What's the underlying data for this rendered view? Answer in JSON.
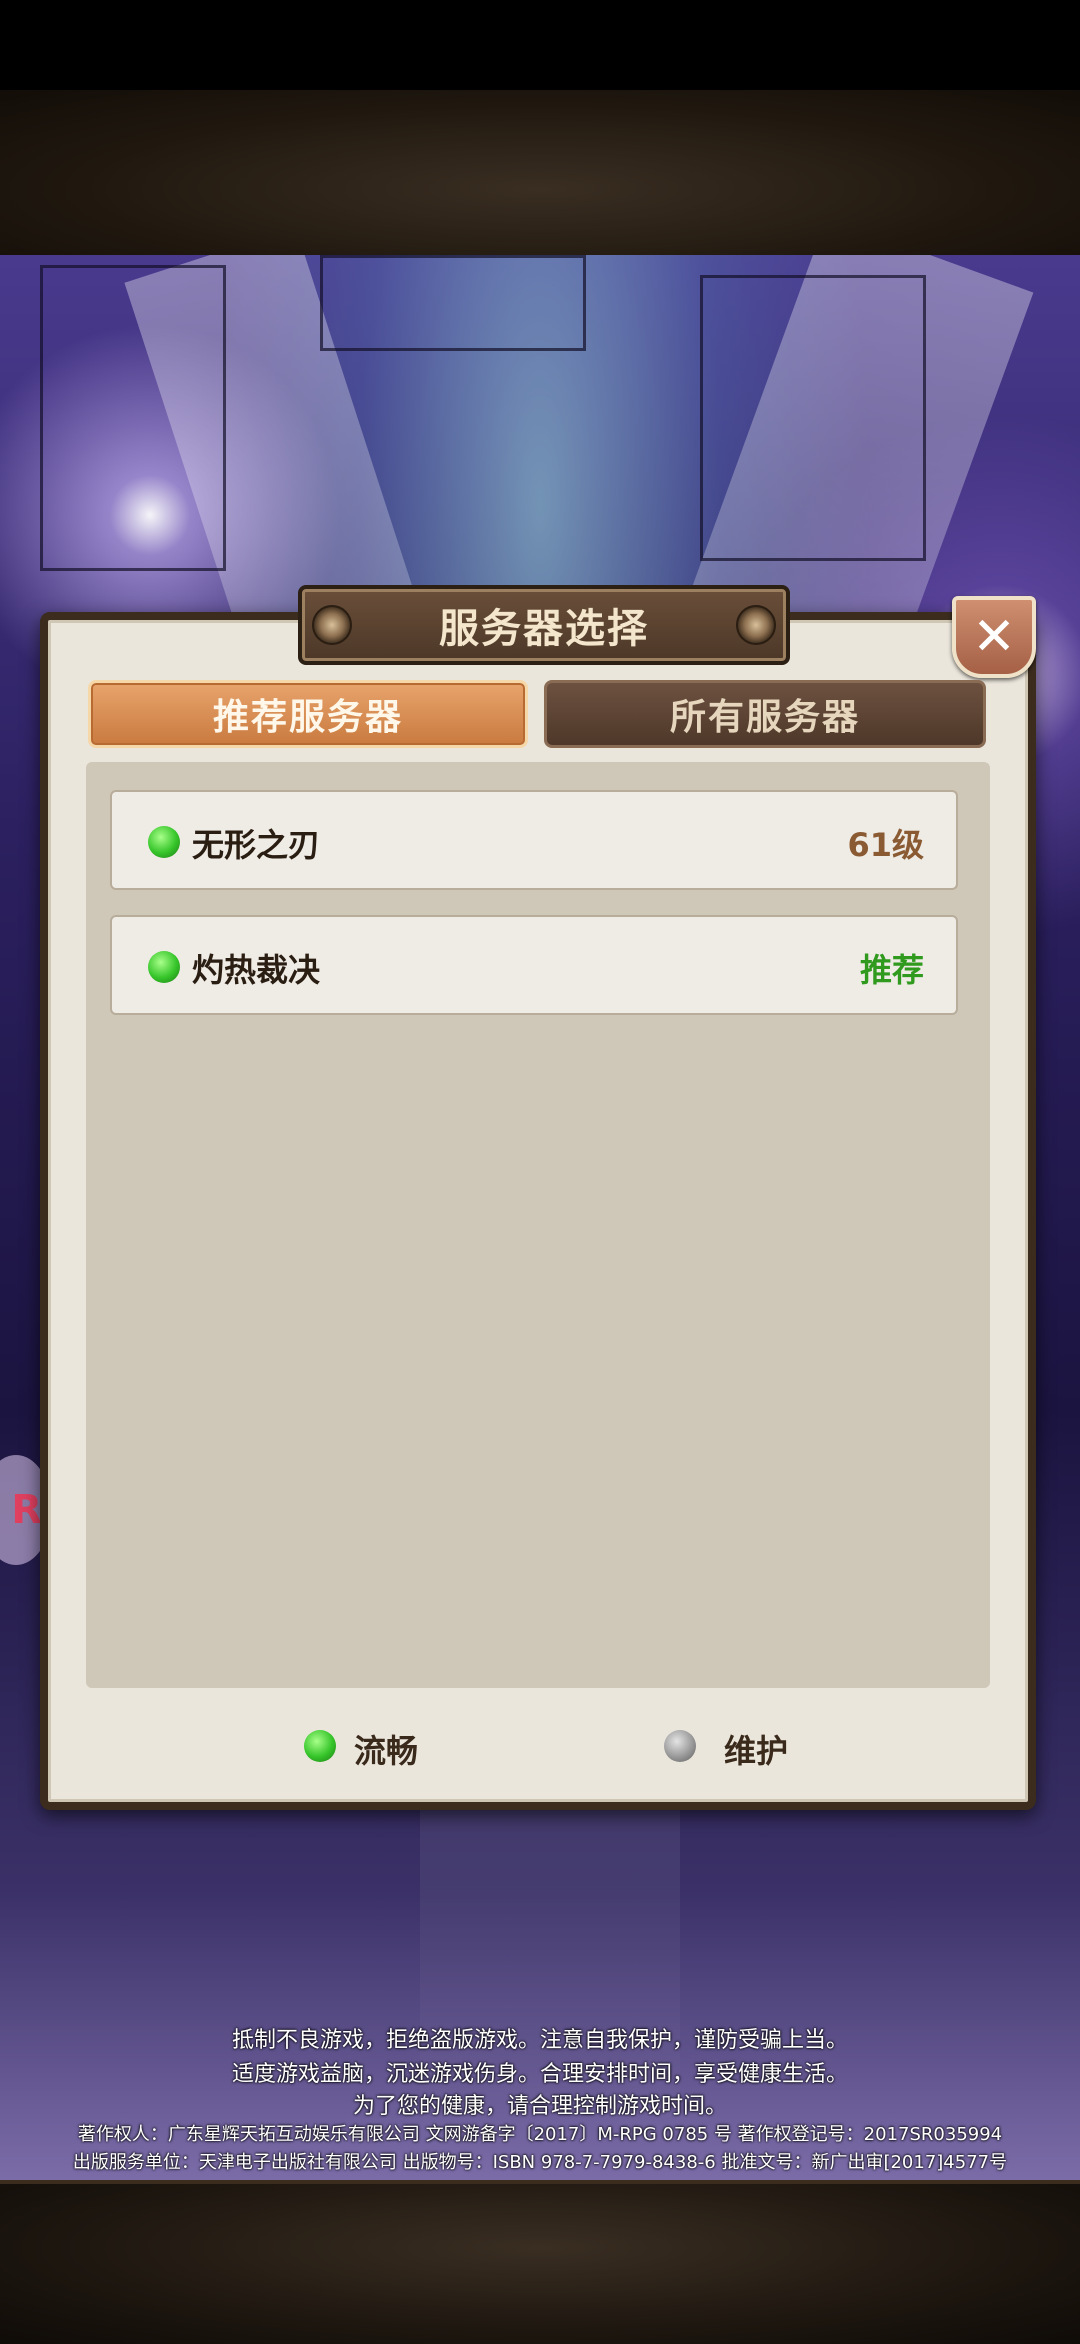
{
  "dialog": {
    "title": "服务器选择",
    "close_icon": "close-icon"
  },
  "tabs": [
    {
      "label": "推荐服务器",
      "active": true
    },
    {
      "label": "所有服务器",
      "active": false
    }
  ],
  "servers": [
    {
      "name": "无形之刃",
      "status": "61级",
      "status_color": "#8a5a32",
      "state": "流畅"
    },
    {
      "name": "灼热裁决",
      "status": "推荐",
      "status_color": "#2f9a1e",
      "state": "流畅"
    }
  ],
  "legend": [
    {
      "label": "流畅",
      "color": "#36c52a"
    },
    {
      "label": "维护",
      "color": "#9a9a9a"
    }
  ],
  "notice": {
    "line1": "抵制不良游戏，拒绝盗版游戏。注意自我保护，谨防受骗上当。",
    "line2": "适度游戏益脑，沉迷游戏伤身。合理安排时间，享受健康生活。",
    "line3": "为了您的健康，请合理控制游戏时间。",
    "line4": "著作权人：广东星辉天拓互动娱乐有限公司 文网游备字〔2017〕M-RPG 0785 号 著作权登记号：2017SR035994",
    "line5": "出版服务单位：天津电子出版社有限公司 出版物号：ISBN 978-7-7979-8438-6 批准文号：新广出审[2017]4577号"
  }
}
